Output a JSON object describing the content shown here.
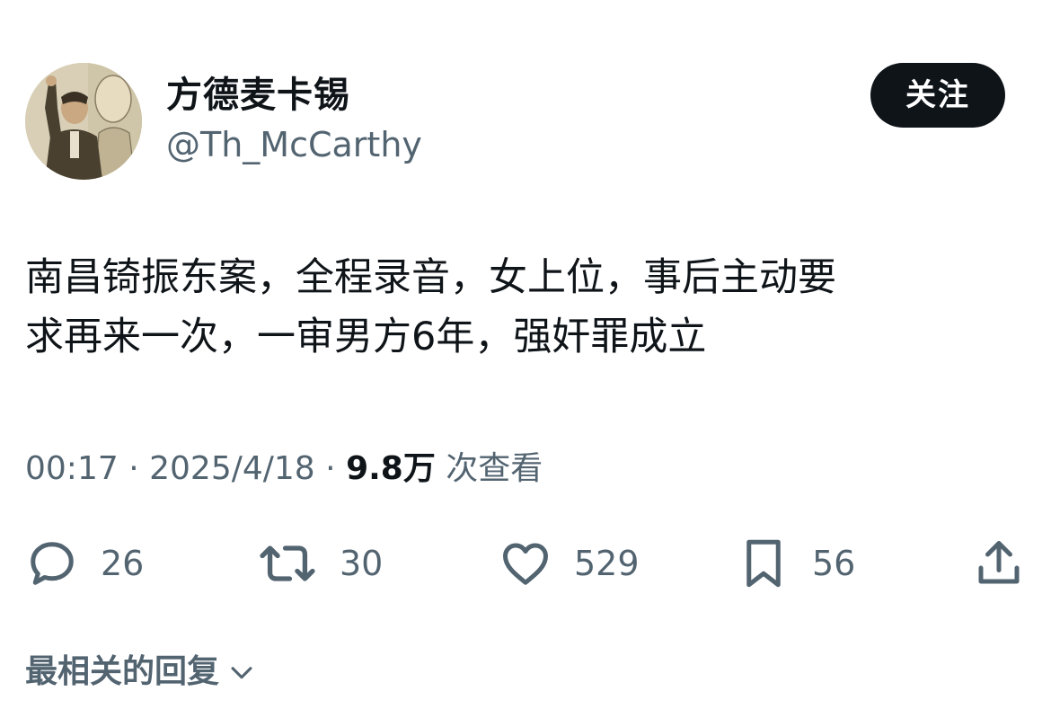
{
  "author": {
    "display_name": "方德麦卡锡",
    "handle": "@Th_McCarthy"
  },
  "follow_button": {
    "label": "关注"
  },
  "tweet": {
    "text": "南昌锜振东案，全程录音，女上位，事后主动要\n求再来一次，一审男方6年，强奸罪成立",
    "time": "00:17",
    "date": "2025/4/18",
    "separator": "·",
    "views_count": "9.8万",
    "views_label": "次查看"
  },
  "actions": {
    "reply": {
      "icon": "reply-icon",
      "count": "26"
    },
    "retweet": {
      "icon": "retweet-icon",
      "count": "30"
    },
    "like": {
      "icon": "heart-icon",
      "count": "529"
    },
    "bookmark": {
      "icon": "bookmark-icon",
      "count": "56"
    },
    "share": {
      "icon": "share-icon"
    }
  },
  "replies_section": {
    "label": "最相关的回复"
  },
  "colors": {
    "text_primary": "#0f1419",
    "text_secondary": "#536471",
    "button_bg": "#0f1419",
    "button_text": "#ffffff"
  }
}
